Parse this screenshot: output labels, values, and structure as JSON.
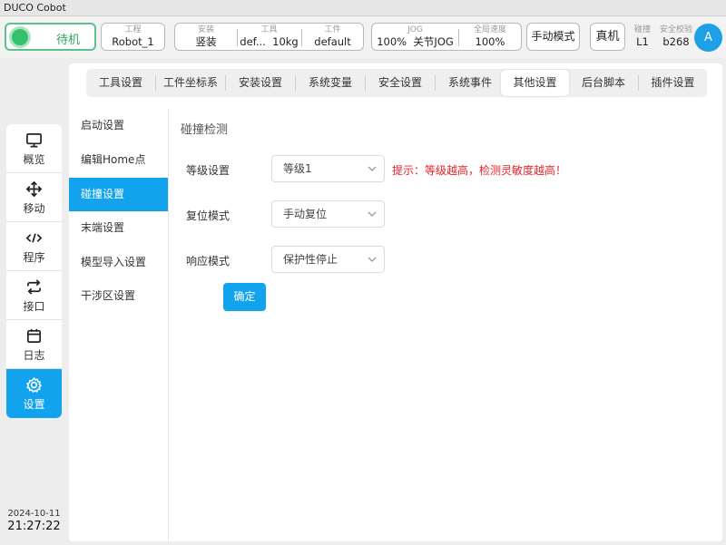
{
  "app": {
    "title": "DUCO Cobot"
  },
  "topbar": {
    "status": "待机",
    "project": {
      "label": "工程",
      "value": "Robot_1"
    },
    "install": {
      "label": "安装",
      "value": "竖装"
    },
    "tool": {
      "label": "工具",
      "name": "def...",
      "weight": "10kg"
    },
    "workpiece": {
      "label": "工件",
      "value": "default"
    },
    "jog": {
      "label": "JOG",
      "percent": "100%",
      "mode": "关节JOG"
    },
    "global_speed": {
      "label": "全局速度",
      "value": "100%"
    },
    "manual_mode": "手动模式",
    "real_machine": "真机",
    "collision": {
      "label": "碰撞",
      "value": "L1"
    },
    "safety_check": {
      "label": "安全校验",
      "value": "b268"
    },
    "avatar": "A"
  },
  "leftnav": {
    "items": [
      {
        "label": "概览",
        "icon": "monitor-icon"
      },
      {
        "label": "移动",
        "icon": "move-icon"
      },
      {
        "label": "程序",
        "icon": "code-icon"
      },
      {
        "label": "接口",
        "icon": "swap-icon"
      },
      {
        "label": "日志",
        "icon": "calendar-icon"
      },
      {
        "label": "设置",
        "icon": "gear-icon",
        "active": true
      }
    ],
    "date": "2024-10-11",
    "time": "21:27:22"
  },
  "tabs": [
    {
      "label": "工具设置"
    },
    {
      "label": "工件坐标系"
    },
    {
      "label": "安装设置"
    },
    {
      "label": "系统变量"
    },
    {
      "label": "安全设置"
    },
    {
      "label": "系统事件"
    },
    {
      "label": "其他设置",
      "active": true
    },
    {
      "label": "后台脚本"
    },
    {
      "label": "插件设置"
    }
  ],
  "subnav": [
    {
      "label": "启动设置"
    },
    {
      "label": "编辑Home点"
    },
    {
      "label": "碰撞设置",
      "active": true
    },
    {
      "label": "末端设置"
    },
    {
      "label": "模型导入设置"
    },
    {
      "label": "干涉区设置"
    }
  ],
  "collision": {
    "title": "碰撞检测",
    "level": {
      "label": "等级设置",
      "value": "等级1"
    },
    "hint": "提示：等级越高，检测灵敏度越高！",
    "reset_mode": {
      "label": "复位模式",
      "value": "手动复位"
    },
    "response_mode": {
      "label": "响应模式",
      "value": "保护性停止"
    },
    "confirm": "确定"
  },
  "colors": {
    "accent": "#12a3ef",
    "status_green": "#35c06b",
    "hint_red": "#e8232a"
  }
}
